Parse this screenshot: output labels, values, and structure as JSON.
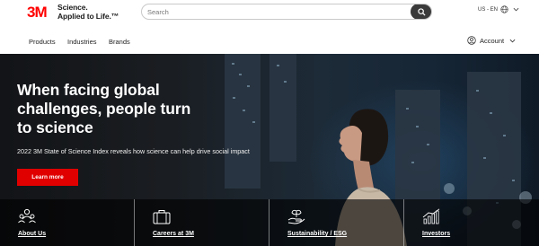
{
  "brand": {
    "logo_text": "3M",
    "tagline_line1": "Science.",
    "tagline_line2": "Applied to Life.™",
    "logo_color": "#ff0000"
  },
  "search": {
    "placeholder": "Search",
    "icon": "search-icon"
  },
  "locale": {
    "label": "US - EN",
    "icon": "globe-icon"
  },
  "nav": {
    "items": [
      {
        "label": "Products"
      },
      {
        "label": "Industries"
      },
      {
        "label": "Brands"
      }
    ],
    "account_label": "Account",
    "account_icon": "user-circle-icon"
  },
  "hero": {
    "title_line1": "When facing global",
    "title_line2": "challenges, people turn",
    "title_line3": "to science",
    "subtitle": "2022 3M State of Science Index reveals how science can help drive social impact",
    "cta_label": "Learn more",
    "cta_color": "#e00000"
  },
  "cards": [
    {
      "label": "About Us",
      "icon": "people-icon"
    },
    {
      "label": "Careers at 3M",
      "icon": "briefcase-icon"
    },
    {
      "label": "Sustainability / ESG",
      "icon": "hand-leaf-icon"
    },
    {
      "label": "Investors",
      "icon": "bar-chart-icon"
    }
  ]
}
